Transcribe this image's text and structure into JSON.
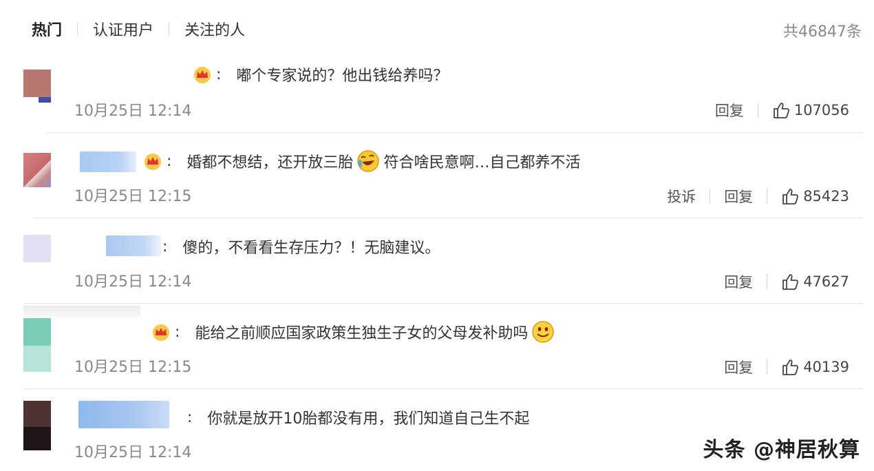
{
  "tabs": [
    "热门",
    "认证用户",
    "关注的人"
  ],
  "total_count": "共46847条",
  "reply_label": "回复",
  "report_label": "投诉",
  "comments": [
    {
      "text": "嘟个专家说的？他出钱给养吗？",
      "time": "10月25日 12:14",
      "likes": "107056"
    },
    {
      "text_a": "婚都不想结，还开放三胎",
      "text_b": "符合啥民意啊…自己都养不活",
      "time": "10月25日 12:15",
      "likes": "85423"
    },
    {
      "text": "傻的，不看看生存压力？！无脑建议。",
      "time": "10月25日 12:14",
      "likes": "47627"
    },
    {
      "text": "能给之前顺应国家政策生独生子女的父母发补助吗",
      "time": "10月25日 12:15",
      "likes": "40139"
    },
    {
      "text": "你就是放开10胎都没有用，我们知道自己生不起",
      "time": "10月25日 12:14"
    }
  ],
  "watermark": "头条 @神居秋算",
  "colors": {
    "accent_tab": "#222222",
    "muted": "#888888"
  }
}
